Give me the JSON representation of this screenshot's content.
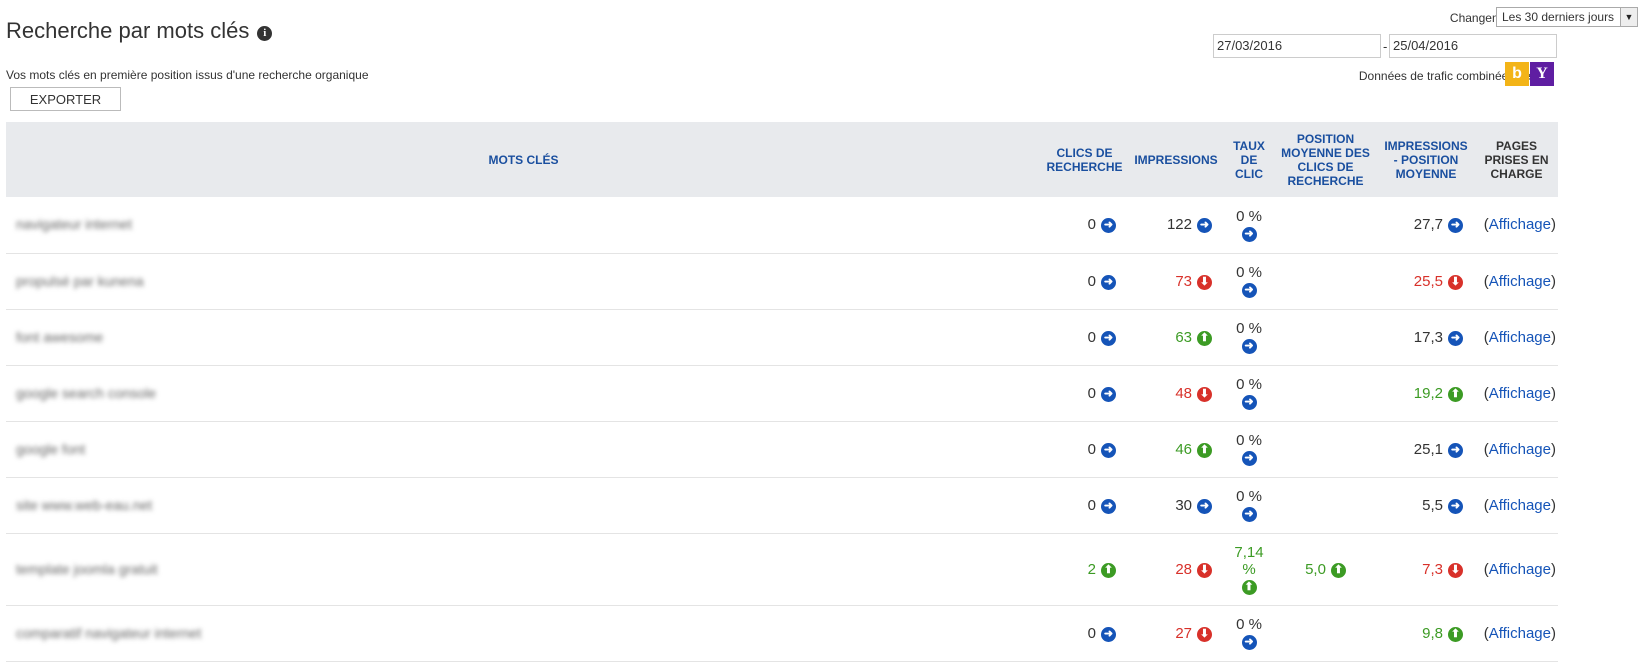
{
  "header": {
    "title": "Recherche par mots clés",
    "subtitle": "Vos mots clés en première position issus d'une recherche organique",
    "export_label": "EXPORTER",
    "changes_label": "Changements pour",
    "period_selected": "Les 30 derniers jours",
    "date_from": "27/03/2016",
    "date_sep": "-",
    "date_to": "25/04/2016",
    "traffic_label": "Données de trafic combinées de",
    "engines": [
      "bing-icon",
      "yahoo-icon"
    ]
  },
  "colors": {
    "up": "#3c9b24",
    "down": "#d8312a",
    "neutral": "#1554b8",
    "header_bg": "#e8eaed"
  },
  "table": {
    "headers": {
      "keyword": "MOTS CLÉS",
      "clicks": "CLICS DE RECHERCHE",
      "impressions": "IMPRESSIONS",
      "ctr": "TAUX DE CLIC",
      "avg_click_pos": "POSITION MOYENNE DES CLICS DE RECHERCHE",
      "avg_imp_pos": "IMPRESSIONS - POSITION MOYENNE",
      "pages": "PAGES PRISES EN CHARGE"
    },
    "rows": [
      {
        "keyword": "navigateur internet",
        "clicks": "0",
        "clicks_trend": "right",
        "impressions": "122",
        "impressions_trend": "right",
        "ctr": "0 %",
        "ctr_trend": "right",
        "click_pos": "",
        "click_pos_trend": "",
        "imp_pos": "27,7",
        "imp_pos_trend": "right",
        "pages": "Affichage"
      },
      {
        "keyword": "propulsé par kunena",
        "clicks": "0",
        "clicks_trend": "right",
        "impressions": "73",
        "impressions_trend": "down",
        "ctr": "0 %",
        "ctr_trend": "right",
        "click_pos": "",
        "click_pos_trend": "",
        "imp_pos": "25,5",
        "imp_pos_trend": "down",
        "pages": "Affichage"
      },
      {
        "keyword": "font awesome",
        "clicks": "0",
        "clicks_trend": "right",
        "impressions": "63",
        "impressions_trend": "up",
        "ctr": "0 %",
        "ctr_trend": "right",
        "click_pos": "",
        "click_pos_trend": "",
        "imp_pos": "17,3",
        "imp_pos_trend": "right",
        "pages": "Affichage"
      },
      {
        "keyword": "google search console",
        "clicks": "0",
        "clicks_trend": "right",
        "impressions": "48",
        "impressions_trend": "down",
        "ctr": "0 %",
        "ctr_trend": "right",
        "click_pos": "",
        "click_pos_trend": "",
        "imp_pos": "19,2",
        "imp_pos_trend": "up",
        "pages": "Affichage"
      },
      {
        "keyword": "google font",
        "clicks": "0",
        "clicks_trend": "right",
        "impressions": "46",
        "impressions_trend": "up",
        "ctr": "0 %",
        "ctr_trend": "right",
        "click_pos": "",
        "click_pos_trend": "",
        "imp_pos": "25,1",
        "imp_pos_trend": "right",
        "pages": "Affichage"
      },
      {
        "keyword": "site www.web-eau.net",
        "clicks": "0",
        "clicks_trend": "right",
        "impressions": "30",
        "impressions_trend": "right",
        "ctr": "0 %",
        "ctr_trend": "right",
        "click_pos": "",
        "click_pos_trend": "",
        "imp_pos": "5,5",
        "imp_pos_trend": "right",
        "pages": "Affichage"
      },
      {
        "keyword": "template joomla gratuit",
        "clicks": "2",
        "clicks_trend": "up",
        "impressions": "28",
        "impressions_trend": "down",
        "ctr": "7,14 %",
        "ctr_trend": "up",
        "click_pos": "5,0",
        "click_pos_trend": "up",
        "imp_pos": "7,3",
        "imp_pos_trend": "down",
        "pages": "Affichage"
      },
      {
        "keyword": "comparatif navigateur internet",
        "clicks": "0",
        "clicks_trend": "right",
        "impressions": "27",
        "impressions_trend": "down",
        "ctr": "0 %",
        "ctr_trend": "right",
        "click_pos": "",
        "click_pos_trend": "",
        "imp_pos": "9,8",
        "imp_pos_trend": "up",
        "pages": "Affichage"
      }
    ]
  }
}
